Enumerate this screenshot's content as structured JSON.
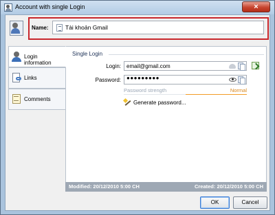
{
  "window": {
    "title": "Account with single Login",
    "close_glyph": "×"
  },
  "header": {
    "name_label": "Name:",
    "name_value": "Tài khoản Gmail",
    "icon": "account-card-icon",
    "highlight_color": "#c8262b"
  },
  "tabs": [
    {
      "label": "Login information",
      "icon": "person-icon",
      "active": true
    },
    {
      "label": "Links",
      "icon": "links-icon",
      "active": false
    },
    {
      "label": "Comments",
      "icon": "comments-icon",
      "active": false
    }
  ],
  "single_login": {
    "group_title": "Single Login",
    "login_label": "Login:",
    "login_value": "email@gmail.com",
    "password_label": "Password:",
    "password_value": "●●●●●●●●●",
    "strength_label": "Password strength",
    "strength_value": "Normal",
    "strength_level": 0.5,
    "strength_color": "#f29a25",
    "generate_label": "Generate password..."
  },
  "status": {
    "modified": "Modified: 20/12/2010 5:00 CH",
    "created": "Created: 20/12/2010 5:00 CH"
  },
  "buttons": {
    "ok": "OK",
    "cancel": "Cancel"
  }
}
